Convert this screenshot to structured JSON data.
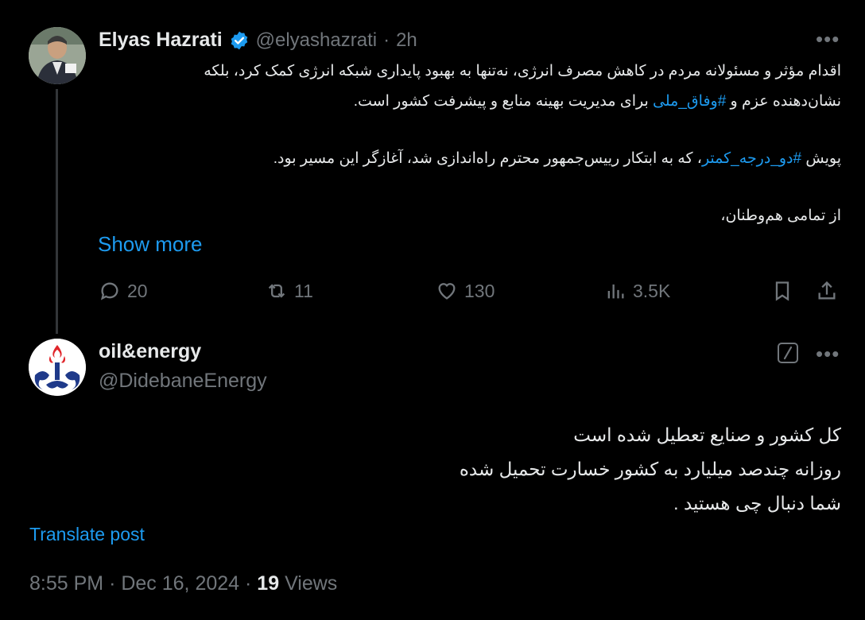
{
  "tweet1": {
    "name": "Elyas Hazrati",
    "handle": "@elyashazrati",
    "sep": "·",
    "time": "2h",
    "line1": "اقدام مؤثر و مسئولانه مردم در کاهش مصرف انرژی، نه‌تنها به بهبود پایداری شبکه انرژی کمک کرد، بلکه",
    "line2_pre": "نشان‌دهنده عزم و ",
    "line2_tag": "#وفاق_ملی",
    "line2_post": " برای مدیریت بهینه منابع و پیشرفت کشور است.",
    "line3_pre": "پویش ",
    "line3_tag": "#دو_درجه_کمتر",
    "line3_post": "، که به ابتکار رییس‌جمهور محترم راه‌اندازی شد، آغازگر این مسیر بود.",
    "line4": "از تمامی هم‌وطنان،",
    "show_more": "Show more",
    "replies": "20",
    "reposts": "11",
    "likes": "130",
    "views": "3.5K"
  },
  "tweet2": {
    "name": "oil&energy",
    "handle": "@DidebaneEnergy",
    "line1": "کل کشور و صنایع تعطیل شده است",
    "line2": "روزانه چندصد میلیارد به کشور خسارت تحمیل شده",
    "line3": "شما دنبال چی هستید .",
    "translate": "Translate post",
    "time": "8:55 PM",
    "date": "Dec 16, 2024",
    "views_count": "19",
    "views_label": "Views"
  },
  "colors": {
    "accent": "#1d9bf0",
    "muted": "#71767b",
    "text": "#e7e9ea",
    "background": "#000000"
  }
}
